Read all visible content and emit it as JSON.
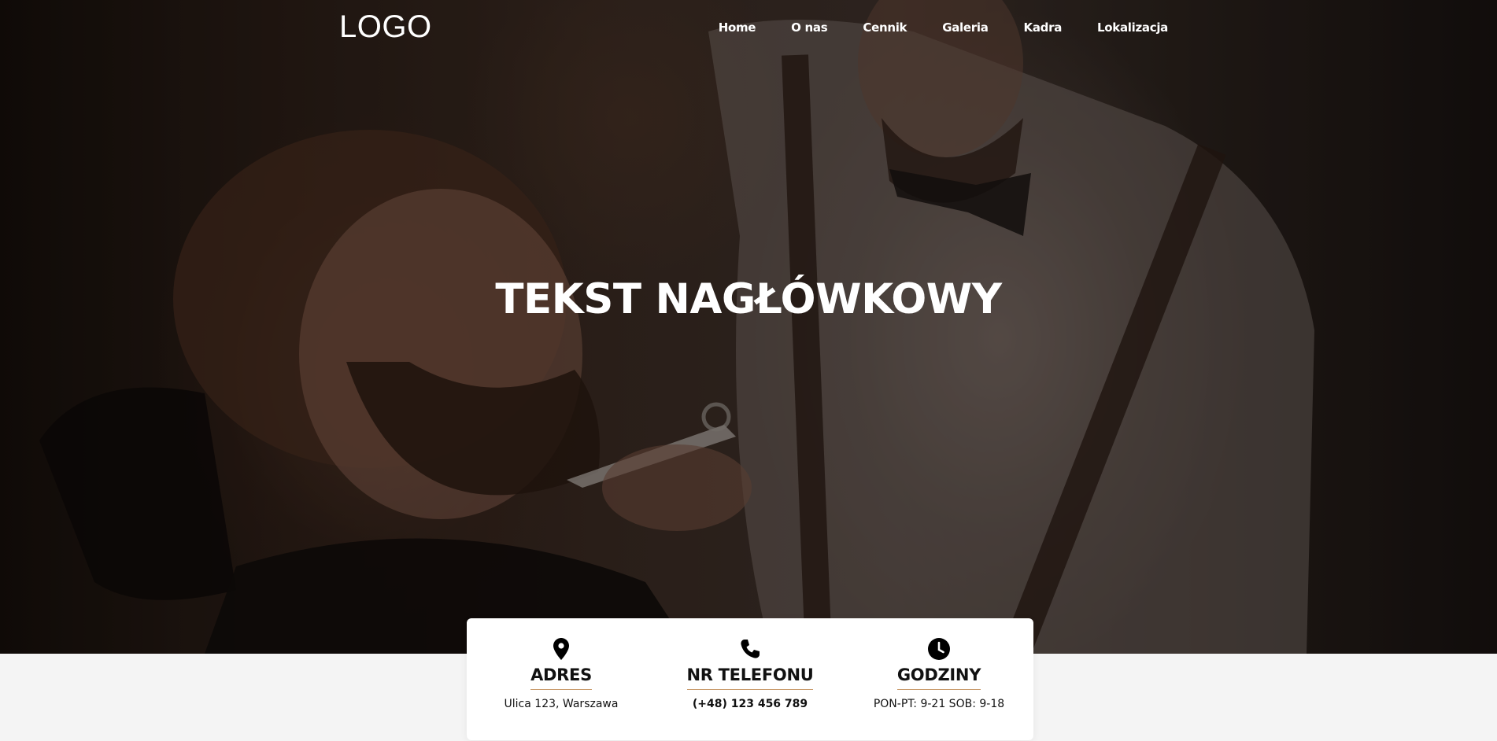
{
  "header": {
    "logo": "LOGO",
    "nav": [
      {
        "label": "Home"
      },
      {
        "label": "O nas"
      },
      {
        "label": "Cennik"
      },
      {
        "label": "Galeria"
      },
      {
        "label": "Kadra"
      },
      {
        "label": "Lokalizacja"
      }
    ]
  },
  "hero": {
    "headline": "TEKST NAGŁÓWKOWY",
    "overlay_color": "#000000"
  },
  "info": [
    {
      "icon": "map-pin-icon",
      "title": "ADRES",
      "text": "Ulica 123, Warszawa"
    },
    {
      "icon": "phone-icon",
      "title": "NR TELEFONU",
      "text": "(+48) 123 456 789"
    },
    {
      "icon": "clock-icon",
      "title": "GODZINY",
      "text": "PON-PT: 9-21 SOB: 9-18"
    }
  ],
  "colors": {
    "accent": "#c89a6a",
    "page_bg": "#f4f4f4",
    "card_bg": "#ffffff",
    "text": "#111111"
  }
}
